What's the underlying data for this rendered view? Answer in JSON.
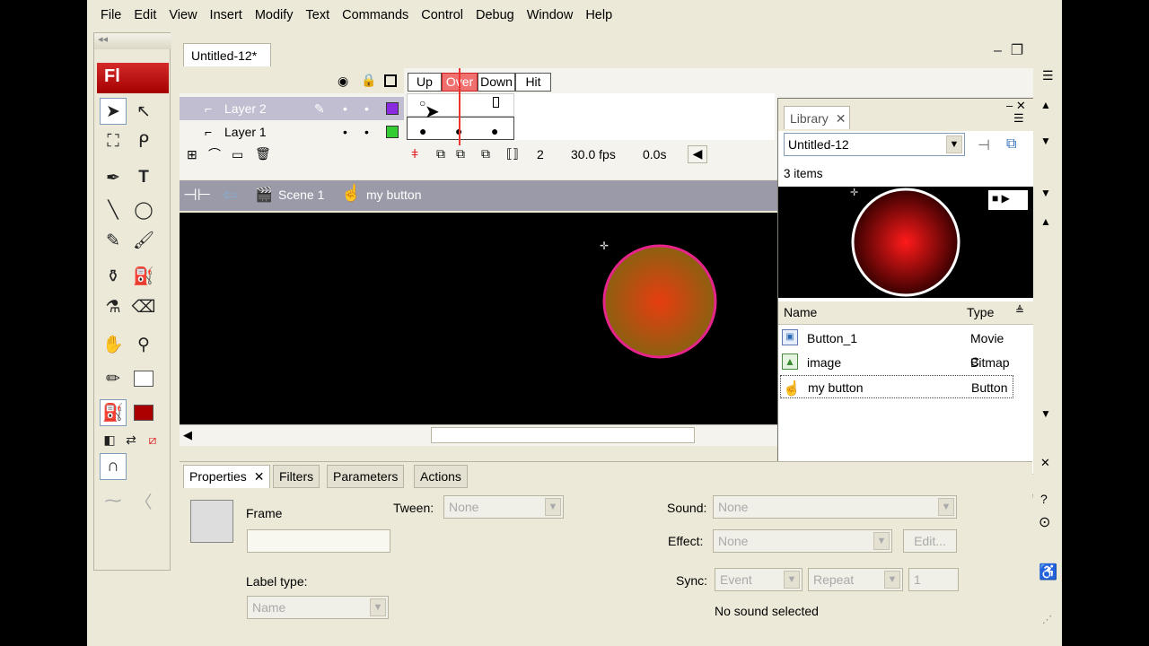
{
  "menu": [
    "File",
    "Edit",
    "View",
    "Insert",
    "Modify",
    "Text",
    "Commands",
    "Control",
    "Debug",
    "Window",
    "Help"
  ],
  "app_logo": "Fl",
  "document": {
    "tab_title": "Untitled-12*"
  },
  "timeline": {
    "frame_labels": [
      "Up",
      "Over",
      "Down",
      "Hit"
    ],
    "active_frame_label": "Over",
    "layers": [
      {
        "name": "Layer 2",
        "selected": true
      },
      {
        "name": "Layer 1",
        "selected": false
      }
    ],
    "current_frame": "2",
    "fps": "30.0 fps",
    "elapsed": "0.0s"
  },
  "breadcrumb": {
    "scene": "Scene 1",
    "symbol": "my button"
  },
  "library": {
    "tab_title": "Library",
    "document": "Untitled-12",
    "item_count": "3 items",
    "columns": {
      "name": "Name",
      "type": "Type"
    },
    "items": [
      {
        "name": "Button_1",
        "type": "Movie C",
        "icon": "movieclip-icon"
      },
      {
        "name": "image",
        "type": "Bitmap",
        "icon": "bitmap-icon"
      },
      {
        "name": "my button",
        "type": "Button",
        "icon": "button-icon",
        "selected": true
      }
    ]
  },
  "properties": {
    "tabs": [
      "Properties",
      "Filters",
      "Parameters",
      "Actions"
    ],
    "frame_label": "Frame",
    "frame_name_value": "",
    "tween_label": "Tween:",
    "tween_value": "None",
    "label_type_label": "Label type:",
    "label_type_value": "Name",
    "sound_label": "Sound:",
    "sound_value": "None",
    "effect_label": "Effect:",
    "effect_value": "None",
    "edit_button": "Edit...",
    "sync_label": "Sync:",
    "sync_value": "Event",
    "repeat_value": "Repeat",
    "repeat_count": "1",
    "sound_status": "No sound selected"
  },
  "colors": {
    "stage_bg": "#000000",
    "accent_red": "#c41a1a",
    "circle_stroke": "#e6248a",
    "frame_over": "#f07070"
  }
}
